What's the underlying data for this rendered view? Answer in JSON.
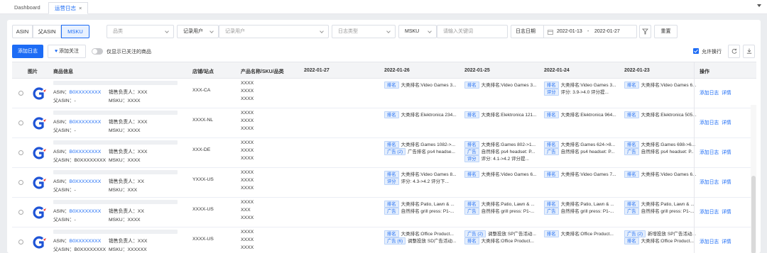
{
  "tabs": {
    "dashboard": "Dashboard",
    "active": "运营日志",
    "close": "×"
  },
  "filters": {
    "seg_asin": "ASIN",
    "seg_parent": "父ASIN",
    "seg_msku": "MSKU",
    "category_placeholder": "品类",
    "recorder_label": "记录用户",
    "recorder_placeholder": "记录用户",
    "logtype_placeholder": "日志类型",
    "msku_select": "MSKU",
    "keyword_placeholder": "请输入关键词",
    "date_label": "日志日期",
    "date_start": "2022-01-13",
    "date_sep": "-",
    "date_end": "2022-01-27",
    "reset": "重置"
  },
  "toolbar": {
    "add_log": "添加日志",
    "follow": "添加关注",
    "only_followed": "仅显示已关注的商品",
    "wrap_label": "允许换行"
  },
  "columns": {
    "image": "图片",
    "info": "商品信息",
    "store": "店铺/站点",
    "product": "产品名称/SKU/品类",
    "d1": "2022-01-27",
    "d2": "2022-01-26",
    "d3": "2022-01-25",
    "d4": "2022-01-24",
    "d5": "2022-01-23",
    "op": "操作"
  },
  "row_labels": {
    "asin": "ASIN：",
    "parent": "父ASIN：",
    "owner": "销售负责人：",
    "msku": "MSKU：",
    "add": "添加日志",
    "detail": "详情"
  },
  "rows": [
    {
      "asin": "B0XXXXXXXX",
      "parent": "-",
      "owner": "XXX",
      "msku": "XXXX",
      "store": "XXX-CA",
      "p1": "XXXX",
      "p2": "XXXX",
      "p3": "XXXX",
      "d2a_tag": "排名",
      "d2a": "大类排名:Video Games 3...",
      "d3a_tag": "排名",
      "d3a": "大类排名:Video Games 3...",
      "d4a_tag": "排名",
      "d4a": "大类排名:Video Games 3...",
      "d4b_tag": "评分",
      "d4b": "评分: 3.9->4.0 评分提...",
      "d5a_tag": "排名",
      "d5a": "大类排名:Video Games 6..."
    },
    {
      "asin": "B0XXXXXXXX",
      "parent": "-",
      "owner": "XXX",
      "msku": "XXXX",
      "store": "XXXX-NL",
      "p1": "XXXX",
      "p2": "XXXX",
      "p3": "XXXX",
      "d2a_tag": "排名",
      "d2a": "大类排名:Elektronica 234...",
      "d3a_tag": "排名",
      "d3a": "大类排名:Elektronica 121...",
      "d4a_tag": "排名",
      "d4a": "大类排名:Elektronica 964...",
      "d5a_tag": "排名",
      "d5a": "大类排名:Elektronica 505..."
    },
    {
      "asin": "B0XXXXXXXX",
      "parent": "B0XXXXXXXX",
      "owner": "XXX",
      "msku": "XXXX",
      "store": "XXX-DE",
      "p1": "XXXX",
      "p2": "XXXX",
      "p3": "XXXX",
      "d2a_tag": "排名",
      "d2a": "大类排名:Games 1082->...",
      "d2b_tag": "广告 (2)",
      "d2b": "广告排名 ps4 headse...",
      "d3a_tag": "排名",
      "d3a": "大类排名:Games 802->1...",
      "d3b_tag": "广告",
      "d3b": "自然排名 ps4 headset: P...",
      "d3c_tag": "评分",
      "d3c": "评分: 4.1->4.2 评分提...",
      "d4a_tag": "排名",
      "d4a": "大类排名:Games 624->8...",
      "d4b_tag": "广告",
      "d4b": "自然排名 ps4 headset: P...",
      "d5a_tag": "排名",
      "d5a": "大类排名:Games 698->6...",
      "d5b_tag": "广告",
      "d5b": "自然排名 ps4 headset: P..."
    },
    {
      "asin": "B0XXXXXXXX",
      "parent": "-",
      "owner": "XX",
      "msku": "XXX",
      "store": "YXXX-US",
      "p1": "XXXX",
      "p2": "XXXX",
      "p3": "XXXX",
      "d2a_tag": "排名",
      "d2a": "大类排名:Video Games 8...",
      "d2b_tag": "评分",
      "d2b": "评分: 4.3->4.2 评分下...",
      "d3a_tag": "排名",
      "d3a": "大类排名:Video Games 6...",
      "d4a_tag": "排名",
      "d4a": "大类排名:Video Games 7...",
      "d5a_tag": "排名",
      "d5a": "大类排名:Video Games 6..."
    },
    {
      "asin": "B0XXXXXXXX",
      "parent": "-",
      "owner": "XX",
      "msku": "XXXX",
      "store": "XXXX-US",
      "p1": "XXXX",
      "p2": "XXX",
      "p3": "XXXX",
      "d2a_tag": "排名",
      "d2a": "大类排名:Patio, Lawn & ...",
      "d2b_tag": "广告",
      "d2b": "自然排名 grill press: P1-...",
      "d3a_tag": "排名",
      "d3a": "大类排名:Patio, Lawn & ...",
      "d3b_tag": "广告",
      "d3b": "自然排名 grill press: P1-...",
      "d4a_tag": "排名",
      "d4a": "大类排名:Patio, Lawn & ...",
      "d4b_tag": "广告",
      "d4b": "自然排名 grill press: P1-...",
      "d5a_tag": "排名",
      "d5a": "大类排名:Patio, Lawn & ...",
      "d5b_tag": "广告",
      "d5b": "自然排名 grill press: P1-..."
    },
    {
      "asin": "B0XXXXXXXX",
      "parent": "B0XXXXXXXX",
      "owner": "XXX",
      "msku": "XXXXXX",
      "store": "XXXX-US",
      "p1": "XXXX",
      "p2": "XXXX",
      "p3": "XXXX",
      "d2a_tag": "排名",
      "d2a": "大类排名:Office Product...",
      "d2b_tag": "广告 (6)",
      "d2b": "调整投放 SD广告活动...",
      "d3a_tag": "广告 (2)",
      "d3a": "调整投放 SP广告活动...",
      "d3b_tag": "排名",
      "d3b": "大类排名:Office Product...",
      "d4a_tag": "排名",
      "d4a": "大类排名:Office Product...",
      "d5a_tag": "广告 (2)",
      "d5a": "新增投放 SP广告活动...",
      "d5b_tag": "排名",
      "d5b": "大类排名:Office Product..."
    }
  ]
}
